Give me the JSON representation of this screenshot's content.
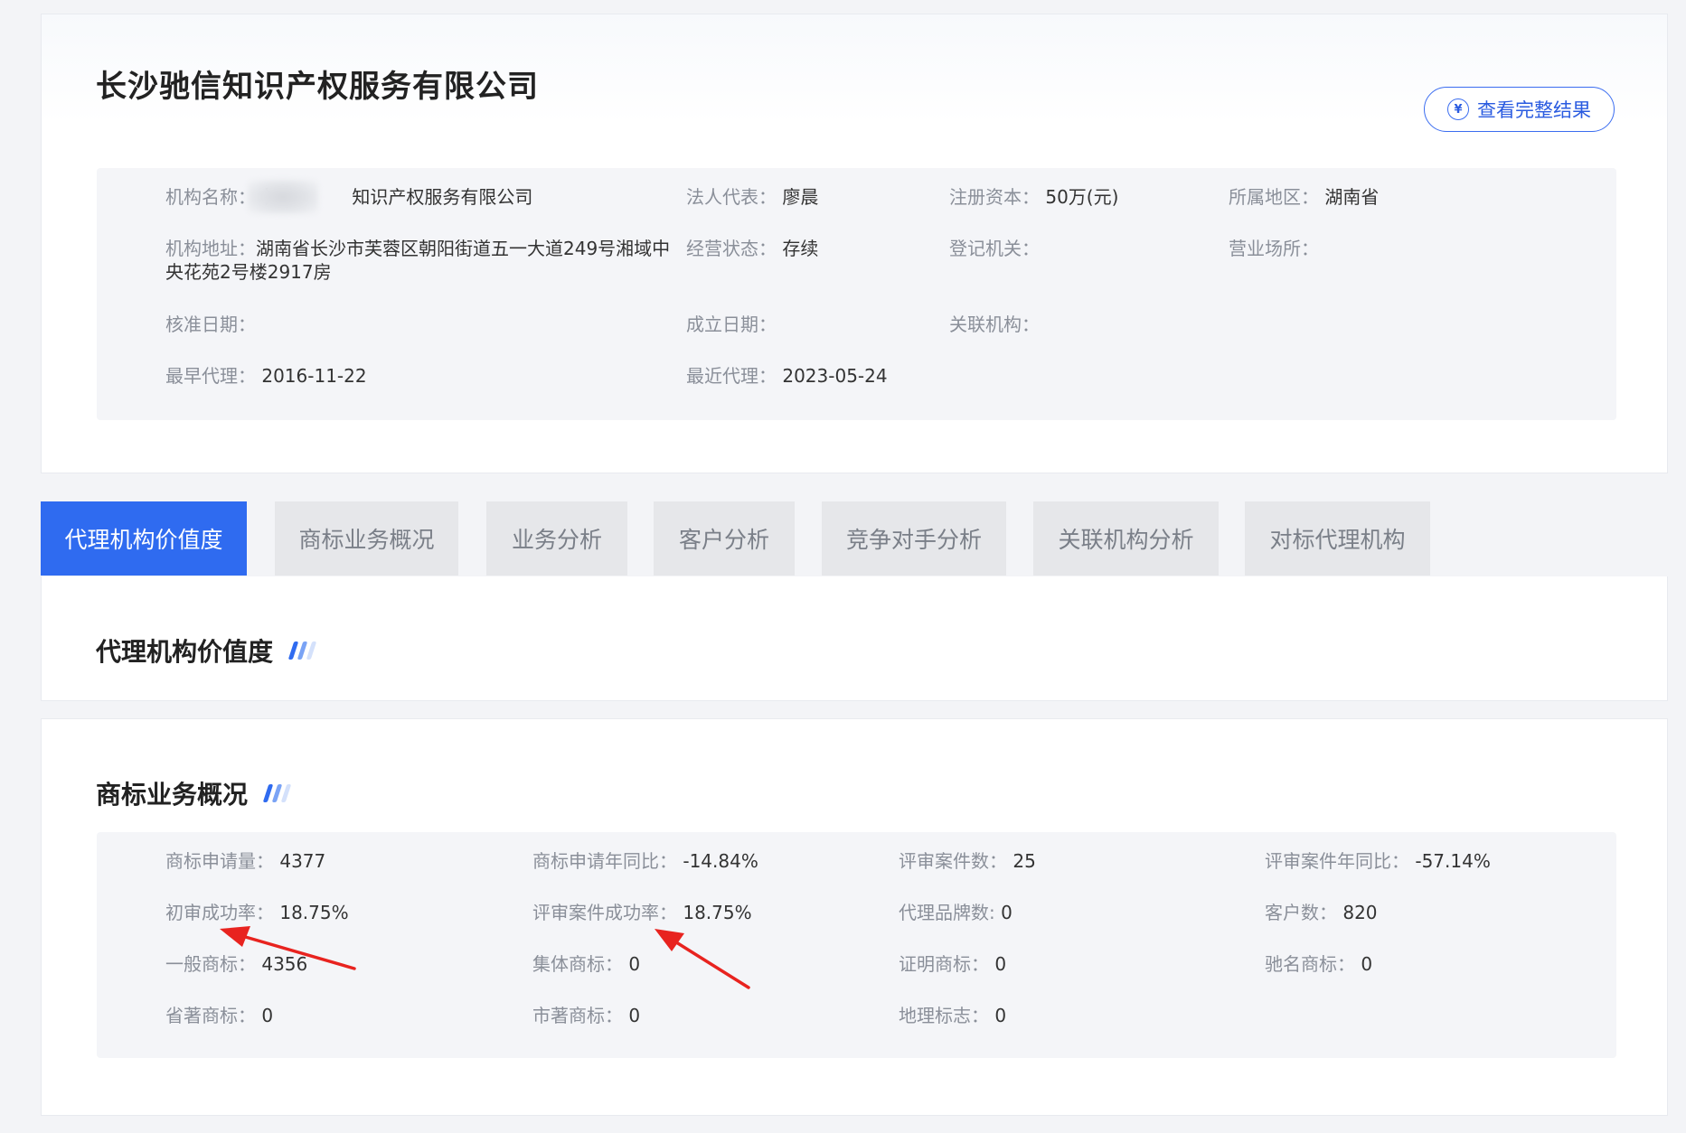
{
  "company": {
    "title": "长沙驰信知识产权服务有限公司"
  },
  "actions": {
    "view_full_result": "查看完整结果",
    "yen_glyph": "¥"
  },
  "info": {
    "org_name_label": "机构名称：",
    "org_name_value": "长沙　　　知识产权服务有限公司",
    "legal_rep_label": "法人代表：",
    "legal_rep_value": "廖晨",
    "capital_label": "注册资本：",
    "capital_value": "50万(元)",
    "region_label": "所属地区：",
    "region_value": "湖南省",
    "address_label": "机构地址：",
    "address_value": "湖南省长沙市芙蓉区朝阳街道五一大道249号湘域中央花苑2号楼2917房",
    "status_label": "经营状态：",
    "status_value": "存续",
    "registrar_label": "登记机关：",
    "registrar_value": "",
    "premises_label": "营业场所：",
    "premises_value": "",
    "approval_date_label": "核准日期：",
    "approval_date_value": "",
    "founded_label": "成立日期：",
    "founded_value": "",
    "related_label": "关联机构：",
    "related_value": "",
    "earliest_label": "最早代理：",
    "earliest_value": "2016-11-22",
    "latest_label": "最近代理：",
    "latest_value": "2023-05-24"
  },
  "tabs": [
    {
      "label": "代理机构价值度",
      "active": true
    },
    {
      "label": "商标业务概况",
      "active": false
    },
    {
      "label": "业务分析",
      "active": false
    },
    {
      "label": "客户分析",
      "active": false
    },
    {
      "label": "竞争对手分析",
      "active": false
    },
    {
      "label": "关联机构分析",
      "active": false
    },
    {
      "label": "对标代理机构",
      "active": false
    }
  ],
  "sections": {
    "value_title": "代理机构价值度",
    "trademark_title": "商标业务概况"
  },
  "stats": [
    {
      "label": "商标申请量：",
      "value": "4377"
    },
    {
      "label": "商标申请年同比：",
      "value": "-14.84%"
    },
    {
      "label": "评审案件数：",
      "value": "25"
    },
    {
      "label": "评审案件年同比：",
      "value": "-57.14%"
    },
    {
      "label": "初审成功率：",
      "value": "18.75%"
    },
    {
      "label": "评审案件成功率：",
      "value": "18.75%"
    },
    {
      "label": "代理品牌数:",
      "value": "0"
    },
    {
      "label": "客户数：",
      "value": "820"
    },
    {
      "label": "一般商标：",
      "value": "4356"
    },
    {
      "label": "集体商标：",
      "value": "0"
    },
    {
      "label": "证明商标：",
      "value": "0"
    },
    {
      "label": "驰名商标：",
      "value": "0"
    },
    {
      "label": "省著商标：",
      "value": "0"
    },
    {
      "label": "市著商标：",
      "value": "0"
    },
    {
      "label": "地理标志：",
      "value": "0"
    }
  ],
  "colors": {
    "accent": "#2f6bf0",
    "annotation": "#e8231f"
  }
}
